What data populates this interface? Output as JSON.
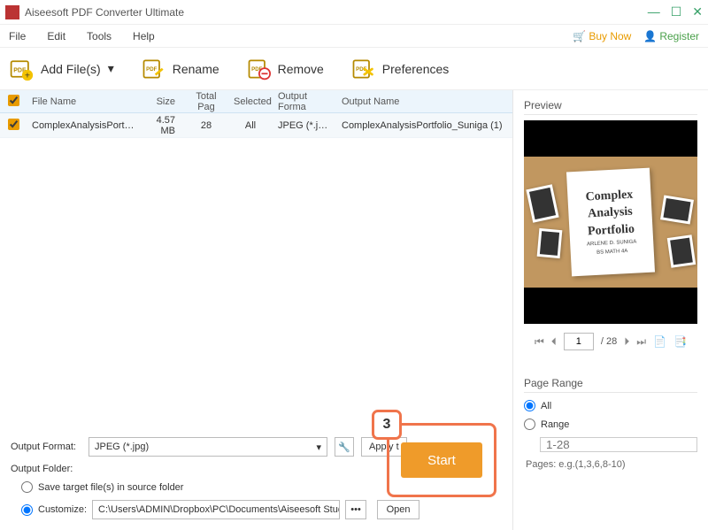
{
  "window": {
    "title": "Aiseesoft PDF Converter Ultimate"
  },
  "menu": {
    "file": "File",
    "edit": "Edit",
    "tools": "Tools",
    "help": "Help",
    "buy": "Buy Now",
    "register": "Register"
  },
  "toolbar": {
    "add": "Add File(s)",
    "rename": "Rename",
    "remove": "Remove",
    "preferences": "Preferences"
  },
  "table": {
    "headers": {
      "filename": "File Name",
      "size": "Size",
      "totalpages": "Total Pag",
      "selected": "Selected",
      "outputfmt": "Output Forma",
      "outputname": "Output Name"
    },
    "rows": [
      {
        "filename": "ComplexAnalysisPortfolio_S...",
        "size": "4.57 MB",
        "pages": "28",
        "selected": "All",
        "fmt": "JPEG (*.jpg)",
        "outname": "ComplexAnalysisPortfolio_Suniga (1)"
      }
    ]
  },
  "bottom": {
    "output_format_label": "Output Format:",
    "output_format_value": "JPEG (*.jpg)",
    "apply": "Apply t",
    "output_folder_label": "Output Folder:",
    "save_source_label": "Save target file(s) in source folder",
    "customize_label": "Customize:",
    "customize_path": "C:\\Users\\ADMIN\\Dropbox\\PC\\Documents\\Aiseesoft Studio\\Aiseesoft P",
    "open": "Open",
    "start": "Start",
    "step_badge": "3"
  },
  "preview": {
    "title": "Preview",
    "note_line1": "Complex",
    "note_line2": "Analysis",
    "note_line3": "Portfolio",
    "note_sub1": "ARLENE D. SUNIGA",
    "note_sub2": "BS MATH 4A",
    "page_current": "1",
    "page_total": "/ 28"
  },
  "page_range": {
    "title": "Page Range",
    "all": "All",
    "range": "Range",
    "range_placeholder": "1-28",
    "hint": "Pages: e.g.(1,3,6,8-10)"
  }
}
